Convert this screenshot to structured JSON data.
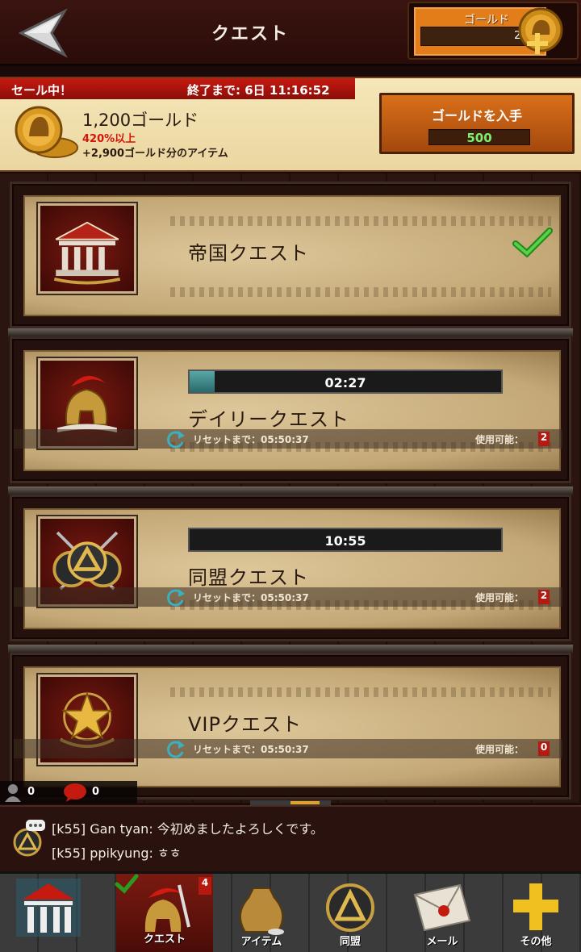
{
  "header": {
    "title": "クエスト",
    "gold_label": "ゴールド",
    "gold_value": "200"
  },
  "sale": {
    "label": "セール中！",
    "timer": "終了まで: 6日 11:16:52",
    "amount": "1,200ゴールド",
    "bonus": "420%以上",
    "items": "+2,900ゴールド分のアイテム",
    "buy_label": "ゴールドを入手",
    "buy_price": "500"
  },
  "quests": [
    {
      "name": "帝国クエスト",
      "icon": "temple-icon",
      "completed": true
    },
    {
      "name": "デイリークエスト",
      "icon": "spartan-helmet-icon",
      "timer": "02:27",
      "progress": 0.08,
      "reset": "リセットまで：05:50:37",
      "available_label": "使用可能：",
      "available": "2"
    },
    {
      "name": "同盟クエスト",
      "icon": "alliance-shield-icon",
      "timer": "10:55",
      "progress": 0.0,
      "reset": "リセットまで：05:50:37",
      "available_label": "使用可能：",
      "available": "2"
    },
    {
      "name": "VIPクエスト",
      "icon": "vip-star-icon",
      "reset": "リセットまで：05:50:37",
      "available_label": "使用可能：",
      "available": "0"
    }
  ],
  "counters": {
    "users": "0",
    "messages": "0"
  },
  "chat": [
    {
      "text": "[k55] Gan tyan: 今初めましたよろしくです。"
    },
    {
      "text": "[k55] ppikyung: ㅎㅎ"
    }
  ],
  "nav": [
    {
      "label": "",
      "icon": "home-temple-icon"
    },
    {
      "label": "クエスト",
      "icon": "quest-helmet-icon",
      "badge": "4",
      "active": true
    },
    {
      "label": "アイテム",
      "icon": "item-bag-icon"
    },
    {
      "label": "同盟",
      "icon": "alliance-icon"
    },
    {
      "label": "メール",
      "icon": "mail-icon"
    },
    {
      "label": "その他",
      "icon": "plus-icon"
    }
  ],
  "colors": {
    "accent": "#e27d1a",
    "sale_red": "#c51a10",
    "price_green": "#7cf06a",
    "progress": "#5aa7a8"
  }
}
